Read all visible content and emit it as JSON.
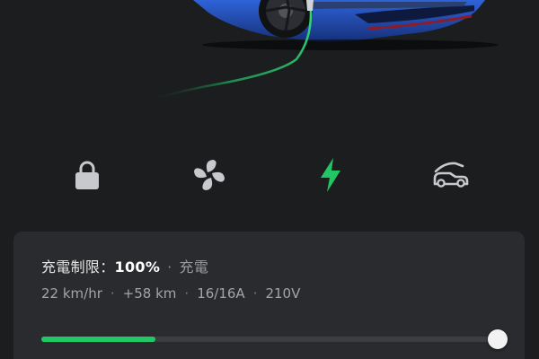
{
  "colors": {
    "background": "#1c1d1f",
    "card": "#2a2b2e",
    "accent_green": "#22c765",
    "icon_gray": "#c8c9cc"
  },
  "controls": [
    {
      "name": "lock",
      "icon": "lock-icon",
      "active": false
    },
    {
      "name": "climate",
      "icon": "fan-icon",
      "active": false
    },
    {
      "name": "charging",
      "icon": "lightning-bolt-icon",
      "active": true
    },
    {
      "name": "frunk",
      "icon": "car-frunk-icon",
      "active": false
    }
  ],
  "charging": {
    "limit_label": "充電制限：",
    "limit_value": "100%",
    "separator": "·",
    "status": "充電",
    "stats": {
      "rate": "22 km/hr",
      "added": "+58 km",
      "current": "16/16A",
      "voltage": "210V"
    },
    "battery_level_fraction": 0.25,
    "limit_fraction": 1.0
  }
}
